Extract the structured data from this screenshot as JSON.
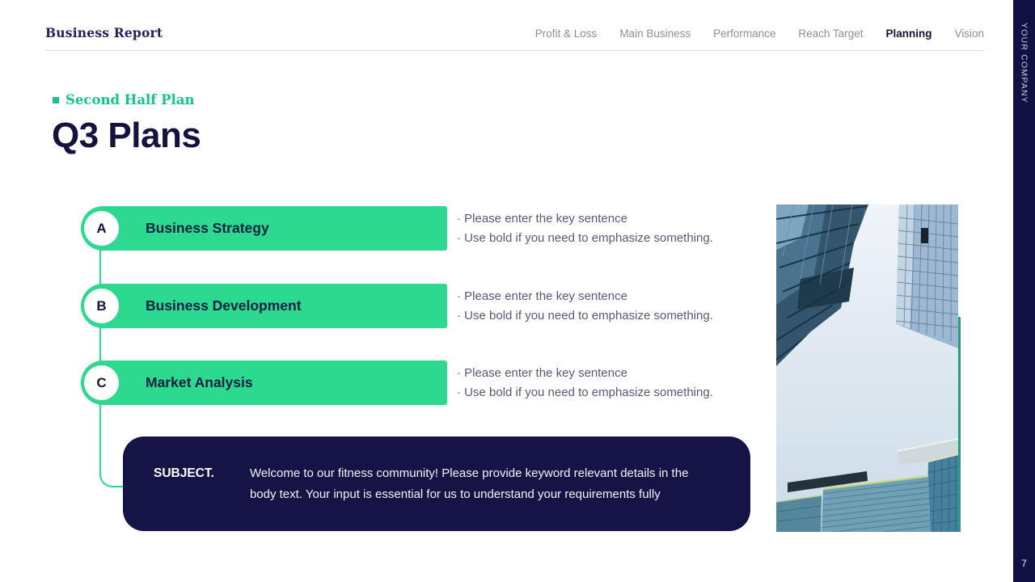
{
  "header": {
    "brand": "Business Report",
    "nav": [
      {
        "label": "Profit & Loss"
      },
      {
        "label": "Main Business"
      },
      {
        "label": "Performance"
      },
      {
        "label": "Reach Target"
      },
      {
        "label": "Planning"
      },
      {
        "label": "Vision"
      }
    ]
  },
  "side_rail": {
    "label": "YOUR COMPANY",
    "page_number": "7"
  },
  "slide": {
    "eyebrow": "Second Half Plan",
    "title": "Q3 Plans",
    "items": [
      {
        "letter": "A",
        "title": "Business Strategy",
        "notes": [
          "·  Please enter the key sentence",
          "· Use bold if you need to emphasize something."
        ]
      },
      {
        "letter": "B",
        "title": "Business Development",
        "notes": [
          "·  Please enter the key sentence",
          "· Use bold if you need to emphasize something."
        ]
      },
      {
        "letter": "C",
        "title": "Market Analysis",
        "notes": [
          "·  Please enter the key sentence",
          "· Use bold if you need to emphasize something."
        ]
      }
    ],
    "subject": {
      "label": "SUBJECT.",
      "body": "Welcome to our fitness community! Please provide keyword relevant details in the body text. Your input is essential for us to understand your requirements fully"
    }
  },
  "image": {
    "label": "low-angle skyscrapers photo"
  },
  "colors": {
    "accent_green": "#2cd98e",
    "eyebrow_green": "#16c48b",
    "navy": "#131143"
  }
}
